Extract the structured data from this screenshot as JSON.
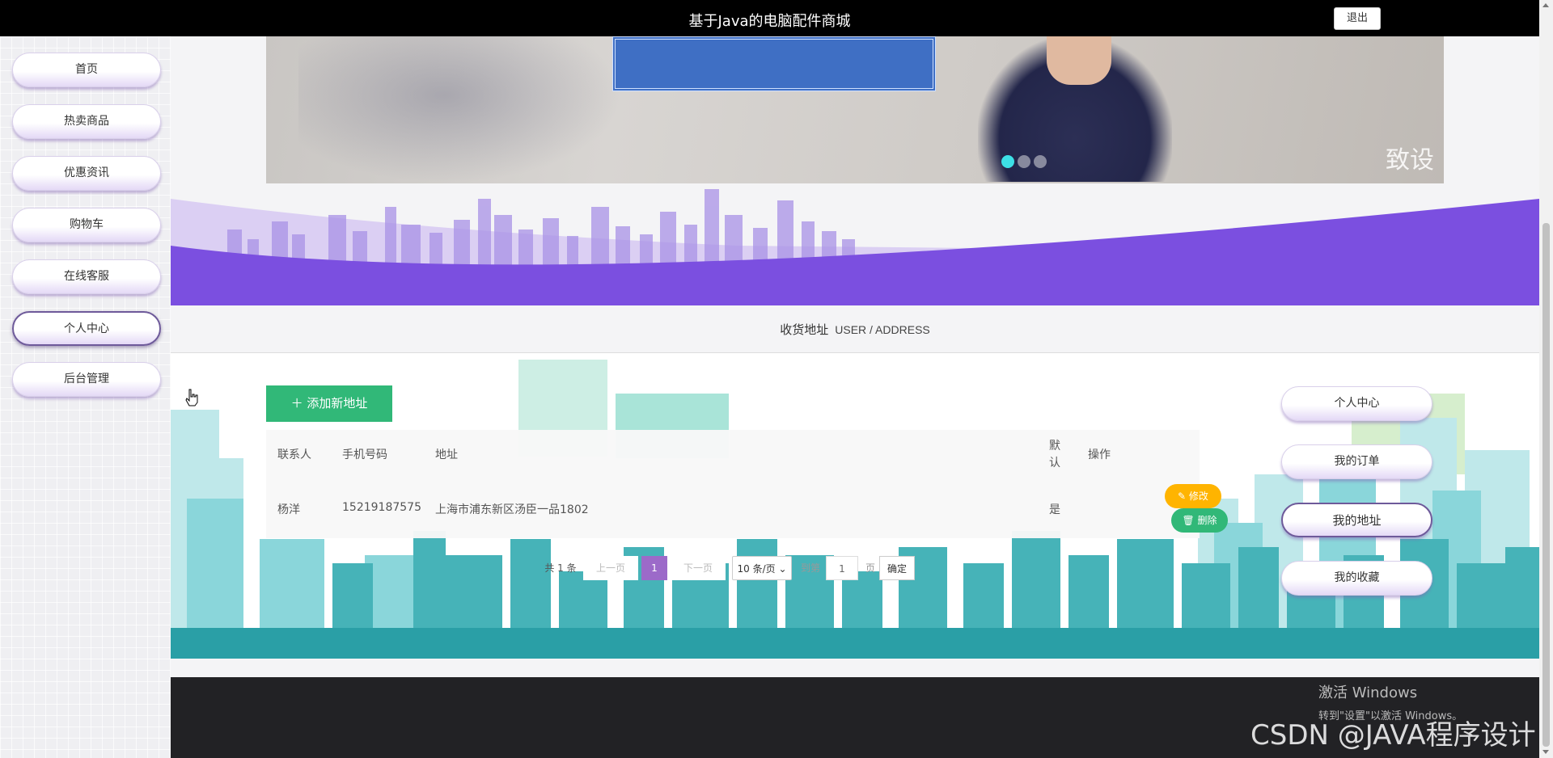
{
  "header": {
    "title": "基于Java的电脑配件商城",
    "logout_label": "退出"
  },
  "sidebar": {
    "items": [
      {
        "label": "首页"
      },
      {
        "label": "热卖商品"
      },
      {
        "label": "优惠资讯"
      },
      {
        "label": "购物车"
      },
      {
        "label": "在线客服"
      },
      {
        "label": "个人中心",
        "active": true
      },
      {
        "label": "后台管理"
      }
    ]
  },
  "banner": {
    "watermark": "致设"
  },
  "section": {
    "title": "收货地址",
    "subtitle": "USER / ADDRESS"
  },
  "address": {
    "add_button_label": "添加新地址",
    "columns": [
      "联系人",
      "手机号码",
      "地址",
      "默认",
      "操作"
    ],
    "rows": [
      {
        "contact": "杨洋",
        "phone": "15219187575",
        "address": "上海市浦东新区汤臣一品1802",
        "default": "是",
        "edit_label": "修改",
        "delete_label": "删除"
      }
    ]
  },
  "pagination": {
    "total": "共 1 条",
    "prev": "上一页",
    "current_page": "1",
    "next": "下一页",
    "page_size": "10 条/页",
    "goto": "到第",
    "page_input": "1",
    "page_unit": "页",
    "confirm": "确定"
  },
  "right_menu": {
    "items": [
      {
        "label": "个人中心"
      },
      {
        "label": "我的订单"
      },
      {
        "label": "我的地址",
        "active": true
      },
      {
        "label": "我的收藏"
      }
    ]
  },
  "overlay": {
    "activate_line1": "激活 Windows",
    "activate_line2": "转到\"设置\"以激活 Windows。",
    "csdn": "CSDN @JAVA程序设计"
  },
  "colors": {
    "green": "#31b878",
    "orange": "#ffb400",
    "purple": "#9c6ac9",
    "wave": "#7b4fe0",
    "footer": "#222225"
  }
}
